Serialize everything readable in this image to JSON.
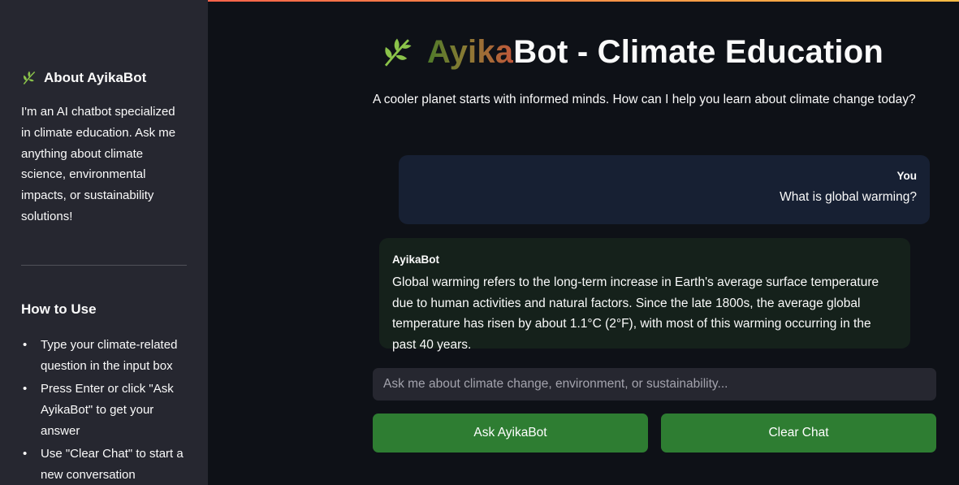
{
  "sidebar": {
    "about_icon": "leaf-icon",
    "about_title": "About AyikaBot",
    "about_text": "I'm an AI chatbot specialized in climate education. Ask me anything about climate science, environmental impacts, or sustainability solutions!",
    "howto_title": "How to Use",
    "howto_items": [
      "Type your climate-related question in the input box",
      "Press Enter or click \"Ask AyikaBot\" to get your answer",
      "Use \"Clear Chat\" to start a new conversation"
    ]
  },
  "header": {
    "icon": "leaf-icon",
    "title_brand": "Ayika",
    "title_rest": "Bot - Climate Education",
    "subtitle": "A cooler planet starts with informed minds. How can I help you learn about climate change today?"
  },
  "chat": {
    "messages": [
      {
        "role": "user",
        "sender": "You",
        "text": "What is global warming?"
      },
      {
        "role": "bot",
        "sender": "AyikaBot",
        "text": "Global warming refers to the long-term increase in Earth's average surface temperature due to human activities and natural factors. Since the late 1800s, the average global temperature has risen by about 1.1°C (2°F), with most of this warming occurring in the past 40 years."
      }
    ]
  },
  "input": {
    "placeholder": "Ask me about climate change, environment, or sustainability...",
    "value": ""
  },
  "buttons": {
    "ask_label": "Ask AyikaBot",
    "clear_label": "Clear Chat"
  },
  "colors": {
    "background": "#0e1117",
    "sidebar": "#262730",
    "user_bubble": "#172033",
    "bot_bubble": "#15211b",
    "button": "#2e7d32"
  }
}
